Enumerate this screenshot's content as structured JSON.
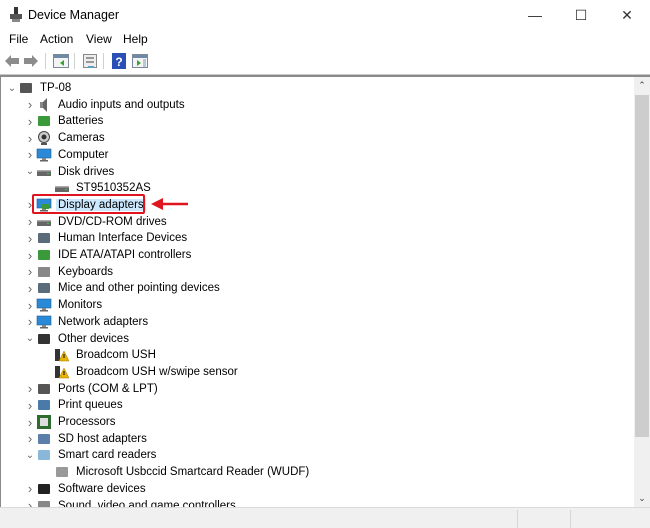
{
  "window": {
    "title": "Device Manager",
    "minimize_glyph": "—",
    "maximize_glyph": "☐",
    "close_glyph": "✕"
  },
  "menu": [
    "File",
    "Action",
    "View",
    "Help"
  ],
  "toolbar": {
    "buttons": [
      {
        "name": "back",
        "icon": "back-arrow-icon"
      },
      {
        "name": "forward",
        "icon": "forward-arrow-icon"
      },
      {
        "name": "show-hide-console-tree",
        "icon": "console-tree-icon"
      },
      {
        "name": "properties",
        "icon": "properties-icon"
      },
      {
        "name": "help",
        "icon": "help-icon",
        "glyph": "?"
      },
      {
        "name": "show-action-pane",
        "icon": "action-pane-icon"
      }
    ]
  },
  "tree": {
    "root": {
      "label": "TP-08",
      "expanded": true,
      "icon": "computer-network-icon"
    },
    "items": [
      {
        "label": "Audio inputs and outputs",
        "level": 1,
        "expander": "collapsed",
        "icon": "speaker-icon"
      },
      {
        "label": "Batteries",
        "level": 1,
        "expander": "collapsed",
        "icon": "battery-icon"
      },
      {
        "label": "Cameras",
        "level": 1,
        "expander": "collapsed",
        "icon": "webcam-icon"
      },
      {
        "label": "Computer",
        "level": 1,
        "expander": "collapsed",
        "icon": "monitor-icon"
      },
      {
        "label": "Disk drives",
        "level": 1,
        "expander": "expanded",
        "icon": "disk-drive-icon"
      },
      {
        "label": "ST9510352AS",
        "level": 2,
        "expander": "none",
        "icon": "disk-drive-icon"
      },
      {
        "label": "Display adapters",
        "level": 1,
        "expander": "collapsed",
        "icon": "display-adapter-icon",
        "selected": true,
        "annotated": true
      },
      {
        "label": "DVD/CD-ROM drives",
        "level": 1,
        "expander": "collapsed",
        "icon": "optical-drive-icon"
      },
      {
        "label": "Human Interface Devices",
        "level": 1,
        "expander": "collapsed",
        "icon": "hid-icon"
      },
      {
        "label": "IDE ATA/ATAPI controllers",
        "level": 1,
        "expander": "collapsed",
        "icon": "ide-controller-icon"
      },
      {
        "label": "Keyboards",
        "level": 1,
        "expander": "collapsed",
        "icon": "keyboard-icon"
      },
      {
        "label": "Mice and other pointing devices",
        "level": 1,
        "expander": "collapsed",
        "icon": "mouse-icon"
      },
      {
        "label": "Monitors",
        "level": 1,
        "expander": "collapsed",
        "icon": "monitor-icon"
      },
      {
        "label": "Network adapters",
        "level": 1,
        "expander": "collapsed",
        "icon": "network-adapter-icon"
      },
      {
        "label": "Other devices",
        "level": 1,
        "expander": "expanded",
        "icon": "unknown-device-icon"
      },
      {
        "label": "Broadcom USH",
        "level": 2,
        "expander": "none",
        "icon": "warning-device-icon"
      },
      {
        "label": "Broadcom USH w/swipe sensor",
        "level": 2,
        "expander": "none",
        "icon": "warning-device-icon"
      },
      {
        "label": "Ports (COM & LPT)",
        "level": 1,
        "expander": "collapsed",
        "icon": "port-icon"
      },
      {
        "label": "Print queues",
        "level": 1,
        "expander": "collapsed",
        "icon": "printer-icon"
      },
      {
        "label": "Processors",
        "level": 1,
        "expander": "collapsed",
        "icon": "processor-icon"
      },
      {
        "label": "SD host adapters",
        "level": 1,
        "expander": "collapsed",
        "icon": "sd-card-icon"
      },
      {
        "label": "Smart card readers",
        "level": 1,
        "expander": "expanded",
        "icon": "smart-card-reader-icon"
      },
      {
        "label": "Microsoft Usbccid Smartcard Reader (WUDF)",
        "level": 2,
        "expander": "none",
        "icon": "smart-card-icon"
      },
      {
        "label": "Software devices",
        "level": 1,
        "expander": "collapsed",
        "icon": "software-device-icon"
      },
      {
        "label": "Sound, video and game controllers",
        "level": 1,
        "expander": "collapsed",
        "icon": "sound-icon"
      }
    ]
  },
  "annotation": {
    "color": "#e0141e",
    "target": "Display adapters"
  },
  "colors": {
    "selection": "#cce8ff",
    "scroll_thumb": "#cdcdcd"
  }
}
